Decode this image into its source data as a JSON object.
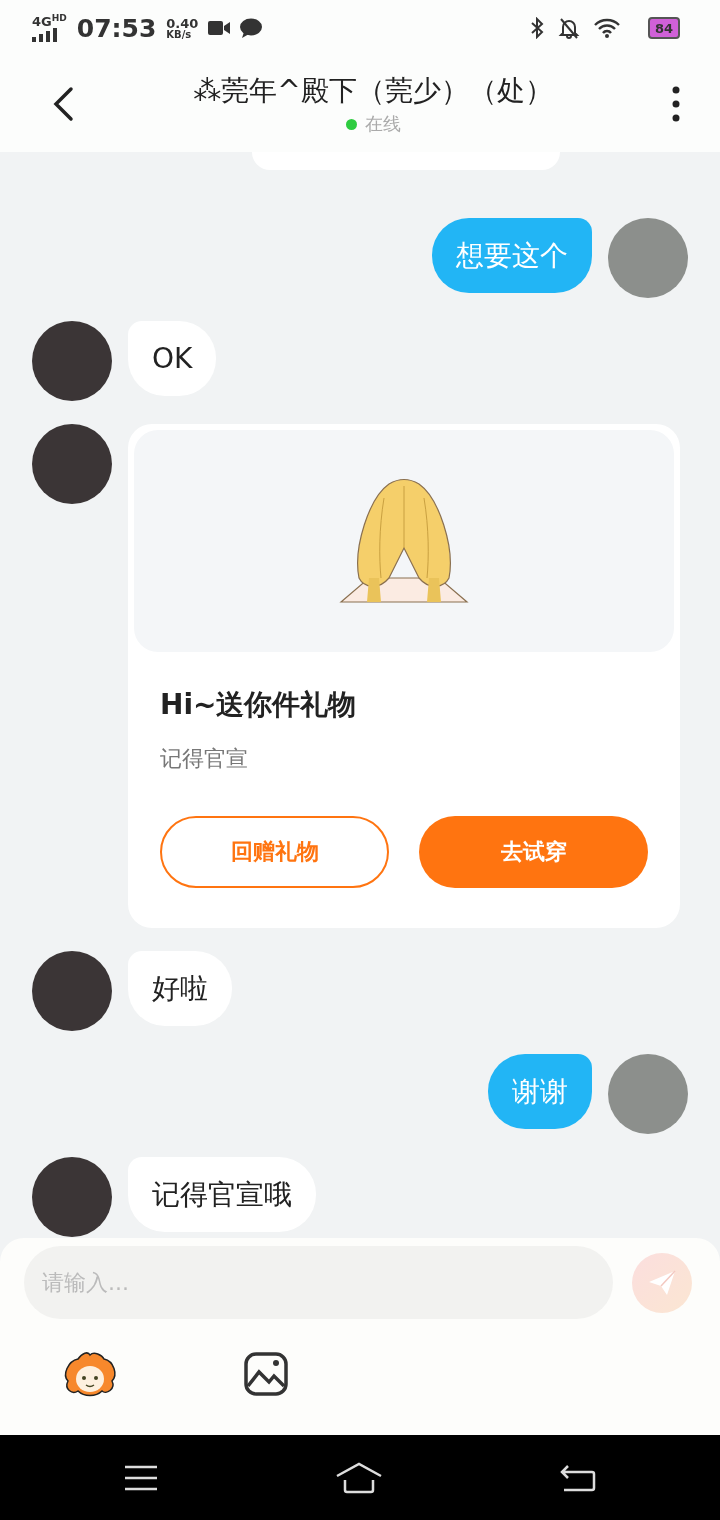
{
  "status_bar": {
    "network": "4G",
    "network_extra": "HD",
    "time": "07:53",
    "speed": "0.40",
    "speed_unit": "KB/s",
    "battery": "84"
  },
  "header": {
    "title": "⁂莞年^殿下（莞少）（处）",
    "presence": "在线",
    "online": true
  },
  "messages": [
    {
      "kind": "text_out",
      "text": "想要这个"
    },
    {
      "kind": "text_in",
      "text": "OK"
    },
    {
      "kind": "gift_in",
      "title": "Hi~送你件礼物",
      "subtitle": "记得官宣",
      "buttons": [
        {
          "label": "回赠礼物",
          "kind": "outline"
        },
        {
          "label": "去试穿",
          "kind": "filled"
        }
      ]
    },
    {
      "kind": "text_in",
      "text": "好啦"
    },
    {
      "kind": "text_out",
      "text": "谢谢"
    },
    {
      "kind": "text_in",
      "text": "记得官宣哦"
    }
  ],
  "composer": {
    "placeholder": "请输入...",
    "send_disabled": true
  }
}
